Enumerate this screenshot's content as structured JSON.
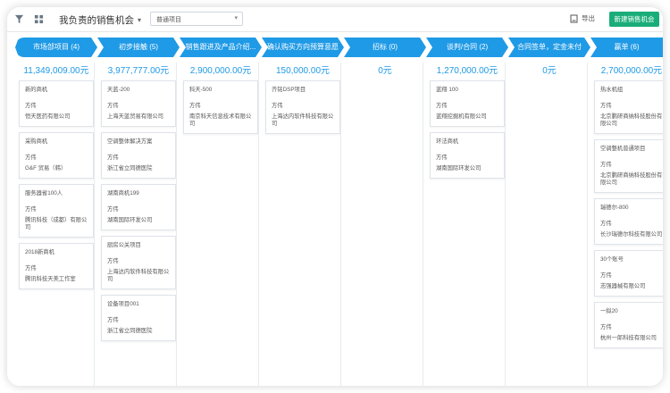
{
  "header": {
    "title": "我负责的销售机会",
    "filter": "普通项目",
    "export_label": "导出",
    "new_button": "新建销售机会"
  },
  "stages": [
    {
      "label": "市场部项目",
      "count": "(4)",
      "amount": "11,349,009.00元"
    },
    {
      "label": "初步接触",
      "count": "(5)",
      "amount": "3,977,777.00元"
    },
    {
      "label": "销售跟进及产品介绍...",
      "count": "",
      "amount": "2,900,000.00元"
    },
    {
      "label": "确认购买方向预算意愿",
      "count": "",
      "amount": "150,000.00元"
    },
    {
      "label": "招标",
      "count": "(0)",
      "amount": "0元"
    },
    {
      "label": "谈判/合同",
      "count": "(2)",
      "amount": "1,270,000.00元"
    },
    {
      "label": "合同签单，定金未付",
      "count": "",
      "amount": "0元"
    },
    {
      "label": "赢单",
      "count": "(6)",
      "amount": "2,700,000.00元"
    }
  ],
  "cards": [
    [
      {
        "name": "新的商机",
        "owner": "方伟",
        "company": "恒天医药有限公司"
      },
      {
        "name": "采购商机",
        "owner": "方伟",
        "company": "G&F 贸易（韩）"
      },
      {
        "name": "服务器省100人",
        "owner": "方伟",
        "company": "腾讯科技（成都）有限公司"
      },
      {
        "name": "2018新商机",
        "owner": "方伟",
        "company": "腾讯科技天美工作室"
      }
    ],
    [
      {
        "name": "天蓝-200",
        "owner": "方伟",
        "company": "上海天蓝贸易有限公司"
      },
      {
        "name": "空调整体解决方案",
        "owner": "方伟",
        "company": "浙江省立同德医院"
      },
      {
        "name": "湖南商机199",
        "owner": "方伟",
        "company": "湖南国际环发公司"
      },
      {
        "name": "厨房公关项目",
        "owner": "方伟",
        "company": "上海达内软件科技有限公司"
      },
      {
        "name": "设备项目001",
        "owner": "方伟",
        "company": "浙江省立同德医院"
      }
    ],
    [
      {
        "name": "科天-500",
        "owner": "方伟",
        "company": "南京科天信息技术有限公司"
      }
    ],
    [
      {
        "name": "齐铭DSP项目",
        "owner": "方伟",
        "company": "上海达内软件科技有限公司"
      }
    ],
    [],
    [
      {
        "name": "蓝翔 100",
        "owner": "方伟",
        "company": "蓝翔挖掘机有限公司"
      },
      {
        "name": "环法商机",
        "owner": "方伟",
        "company": "湖南国际环发公司"
      }
    ],
    [],
    [
      {
        "name": "热水机组",
        "owner": "方伟",
        "company": "北京鹏研商纳科技股份有限公司"
      },
      {
        "name": "空调整机普通项目",
        "owner": "方伟",
        "company": "北京鹏研商纳科技股份有限公司"
      },
      {
        "name": "瑞德尔-800",
        "owner": "方伟",
        "company": "长沙瑞德尔科技有限公司"
      },
      {
        "name": "30个账号",
        "owner": "方伟",
        "company": "志强器械有限公司"
      },
      {
        "name": "一拟20",
        "owner": "方伟",
        "company": "杭州一郎科技有限公司"
      }
    ]
  ]
}
